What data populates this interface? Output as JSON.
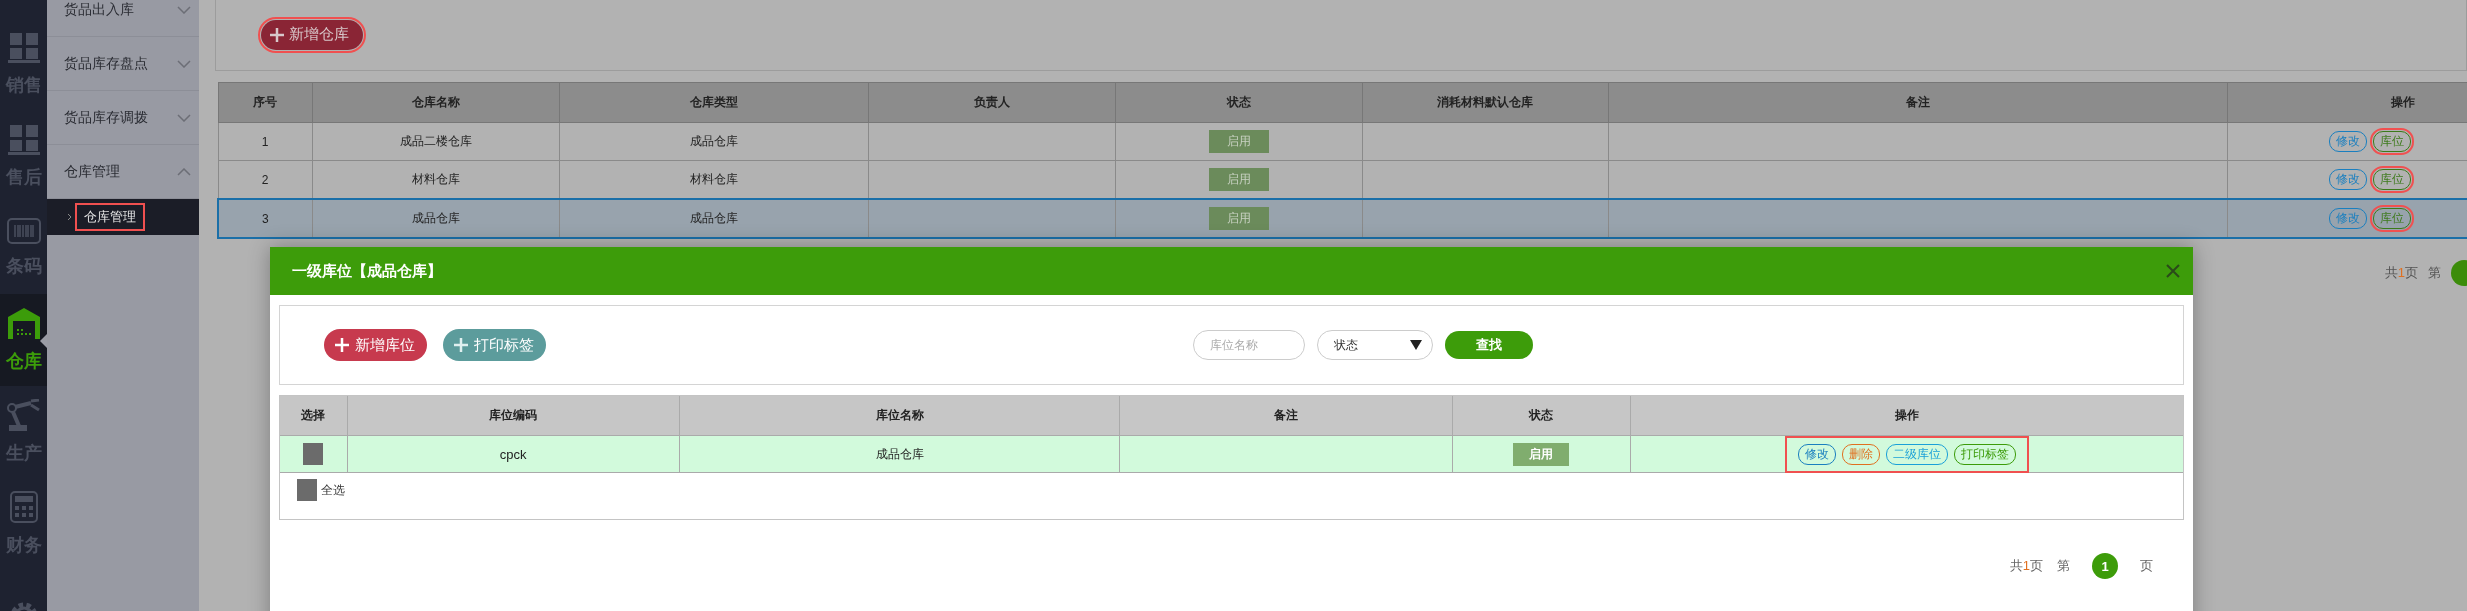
{
  "nav_rail": {
    "items": [
      {
        "label": "销售",
        "kind": "boxes",
        "selected": false
      },
      {
        "label": "售后",
        "kind": "boxes",
        "selected": false
      },
      {
        "label": "条码",
        "kind": "barcode",
        "selected": false
      },
      {
        "label": "仓库",
        "kind": "warehouse",
        "selected": true
      },
      {
        "label": "生产",
        "kind": "robot",
        "selected": false
      },
      {
        "label": "财务",
        "kind": "calculator",
        "selected": false
      },
      {
        "kind": "gear",
        "selected": false
      }
    ]
  },
  "sidebar": {
    "items": [
      {
        "label": "货品出入库",
        "expanded": false
      },
      {
        "label": "货品库存盘点",
        "expanded": false
      },
      {
        "label": "货品库存调拨",
        "expanded": false
      },
      {
        "label": "仓库管理",
        "expanded": true,
        "children": [
          {
            "label": "仓库管理",
            "selected": true,
            "highlighted": true
          }
        ]
      }
    ]
  },
  "toolbar": {
    "add_button": {
      "label": "新增仓库",
      "highlighted": true
    }
  },
  "warehouse_table": {
    "columns": [
      "序号",
      "仓库名称",
      "仓库类型",
      "负责人",
      "状态",
      "消耗材料默认仓库",
      "备注",
      "操作"
    ],
    "rows": [
      {
        "no": "1",
        "name": "成品二楼仓库",
        "type": "成品仓库",
        "status": "启用",
        "selected": false,
        "actions": [
          {
            "label": "修改",
            "kind": "edit",
            "highlighted": false
          },
          {
            "label": "库位",
            "kind": "location",
            "highlighted": true
          }
        ]
      },
      {
        "no": "2",
        "name": "材料仓库",
        "type": "材料仓库",
        "status": "启用",
        "selected": false,
        "actions": [
          {
            "label": "修改",
            "kind": "edit",
            "highlighted": false
          },
          {
            "label": "库位",
            "kind": "location",
            "highlighted": true
          }
        ]
      },
      {
        "no": "3",
        "name": "成品仓库",
        "type": "成品仓库",
        "status": "启用",
        "selected": true,
        "actions": [
          {
            "label": "修改",
            "kind": "edit",
            "highlighted": false
          },
          {
            "label": "库位",
            "kind": "location",
            "highlighted": true
          }
        ]
      }
    ]
  },
  "pagination": {
    "prefix": "共",
    "count": "1",
    "suffix": "页",
    "page_label": "第"
  },
  "dialog": {
    "title": "一级库位【成品仓库】",
    "add_button": "新增库位",
    "print_button": "打印标签",
    "search": {
      "placeholder": "库位名称"
    },
    "status_select": "状态",
    "find_button": "查找",
    "table": {
      "columns": [
        "选择",
        "库位编码",
        "库位名称",
        "备注",
        "状态",
        "操作"
      ],
      "rows": [
        {
          "checked": false,
          "code": "cpck",
          "name": "成品仓库",
          "status": "启用",
          "actions_highlighted": true,
          "actions": [
            {
              "label": "修改",
              "kind": "edit"
            },
            {
              "label": "删除",
              "kind": "delete"
            },
            {
              "label": "二级库位",
              "kind": "sub"
            },
            {
              "label": "打印标签",
              "kind": "print"
            }
          ]
        }
      ],
      "select_all": {
        "label": "全选",
        "checked": false
      }
    },
    "pagination": {
      "prefix": "共",
      "count": "1",
      "suffix": "页",
      "page_label": "第",
      "current": "1",
      "page_suffix": "页"
    }
  }
}
